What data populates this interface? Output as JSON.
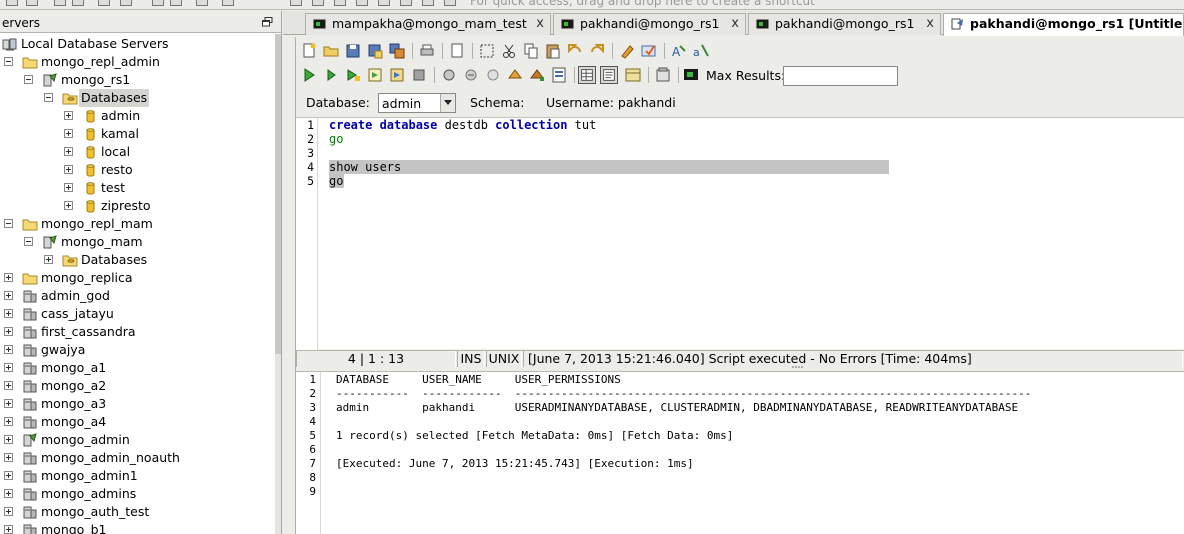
{
  "shortcut_hint": "For quick access, drag and drop here to create a shortcut",
  "left_panel": {
    "title": "ervers",
    "tree": [
      {
        "label": "Local Database Servers",
        "icon": "server-group-icon",
        "level": 0,
        "expander": "none"
      },
      {
        "label": "mongo_repl_admin",
        "icon": "folder-icon",
        "level": 1,
        "expander": "minus"
      },
      {
        "label": "mongo_rs1",
        "icon": "server-connected-icon",
        "level": 2,
        "expander": "minus"
      },
      {
        "label": "Databases",
        "icon": "databases-folder-icon",
        "level": 3,
        "expander": "minus",
        "selected": true
      },
      {
        "label": "admin",
        "icon": "database-icon",
        "level": 4,
        "expander": "plus"
      },
      {
        "label": "kamal",
        "icon": "database-icon",
        "level": 4,
        "expander": "plus"
      },
      {
        "label": "local",
        "icon": "database-icon",
        "level": 4,
        "expander": "plus"
      },
      {
        "label": "resto",
        "icon": "database-icon",
        "level": 4,
        "expander": "plus"
      },
      {
        "label": "test",
        "icon": "database-icon",
        "level": 4,
        "expander": "plus"
      },
      {
        "label": "zipresto",
        "icon": "database-icon",
        "level": 4,
        "expander": "plus"
      },
      {
        "label": "mongo_repl_mam",
        "icon": "folder-icon",
        "level": 1,
        "expander": "minus"
      },
      {
        "label": "mongo_mam",
        "icon": "server-connected-icon",
        "level": 2,
        "expander": "minus"
      },
      {
        "label": "Databases",
        "icon": "databases-folder-icon",
        "level": 3,
        "expander": "plus"
      },
      {
        "label": "mongo_replica",
        "icon": "folder-icon",
        "level": 1,
        "expander": "plus"
      },
      {
        "label": "admin_god",
        "icon": "server-icon",
        "level": 1,
        "expander": "plus"
      },
      {
        "label": "cass_jatayu",
        "icon": "server-icon",
        "level": 1,
        "expander": "plus"
      },
      {
        "label": "first_cassandra",
        "icon": "server-icon",
        "level": 1,
        "expander": "plus"
      },
      {
        "label": "gwajya",
        "icon": "server-icon",
        "level": 1,
        "expander": "plus"
      },
      {
        "label": "mongo_a1",
        "icon": "server-icon",
        "level": 1,
        "expander": "plus"
      },
      {
        "label": "mongo_a2",
        "icon": "server-icon",
        "level": 1,
        "expander": "plus"
      },
      {
        "label": "mongo_a3",
        "icon": "server-icon",
        "level": 1,
        "expander": "plus"
      },
      {
        "label": "mongo_a4",
        "icon": "server-icon",
        "level": 1,
        "expander": "plus"
      },
      {
        "label": "mongo_admin",
        "icon": "server-connected-icon",
        "level": 1,
        "expander": "plus"
      },
      {
        "label": "mongo_admin_noauth",
        "icon": "server-icon",
        "level": 1,
        "expander": "plus"
      },
      {
        "label": "mongo_admin1",
        "icon": "server-icon",
        "level": 1,
        "expander": "plus"
      },
      {
        "label": "mongo_admins",
        "icon": "server-icon",
        "level": 1,
        "expander": "plus"
      },
      {
        "label": "mongo_auth_test",
        "icon": "server-icon",
        "level": 1,
        "expander": "plus"
      },
      {
        "label": "mongo_b1",
        "icon": "server-icon",
        "level": 1,
        "expander": "plus"
      }
    ]
  },
  "tabs": [
    {
      "label": "mampakha@mongo_mam_test",
      "close": "x",
      "active": false
    },
    {
      "label": "pakhandi@mongo_rs1",
      "close": "x",
      "active": false
    },
    {
      "label": "pakhandi@mongo_rs1",
      "close": "x",
      "active": false
    },
    {
      "label": "pakhandi@mongo_rs1 [Untitle",
      "close": "",
      "active": true
    }
  ],
  "toolbar": {
    "max_results_label": "Max Results:",
    "max_results_value": ""
  },
  "db_bar": {
    "database_label": "Database:",
    "database_value": "admin",
    "schema_label": "Schema:",
    "username_label": "Username:",
    "username_value": "pakhandi"
  },
  "editor": {
    "lines": [
      {
        "num": "1",
        "tokens": [
          {
            "t": "create database",
            "c": "kw"
          },
          {
            "t": " destdb ",
            "c": ""
          },
          {
            "t": "collection",
            "c": "kw"
          },
          {
            "t": " tut",
            "c": ""
          }
        ]
      },
      {
        "num": "2",
        "tokens": [
          {
            "t": "go",
            "c": "gr"
          }
        ]
      },
      {
        "num": "3",
        "tokens": []
      },
      {
        "num": "4",
        "tokens": [
          {
            "t": "show users",
            "c": ""
          }
        ]
      },
      {
        "num": "5",
        "tokens": [
          {
            "t": "go",
            "c": ""
          }
        ]
      }
    ]
  },
  "status_bar": {
    "position": "4 | 1 : 13",
    "mode": "INS",
    "line_ending": "UNIX",
    "message": "[June 7, 2013 15:21:46.040] Script executed - No Errors [Time: 404ms]"
  },
  "result": {
    "lines": [
      {
        "num": "1",
        "text": "DATABASE     USER_NAME     USER_PERMISSIONS"
      },
      {
        "num": "2",
        "text": "-----------  ------------  ------------------------------------------------------------------------------"
      },
      {
        "num": "3",
        "text": "admin        pakhandi      USERADMINANYDATABASE, CLUSTERADMIN, DBADMINANYDATABASE, READWRITEANYDATABASE"
      },
      {
        "num": "4",
        "text": ""
      },
      {
        "num": "5",
        "text": "1 record(s) selected [Fetch MetaData: 0ms] [Fetch Data: 0ms]"
      },
      {
        "num": "6",
        "text": ""
      },
      {
        "num": "7",
        "text": "[Executed: June 7, 2013 15:21:45.743] [Execution: 1ms]"
      },
      {
        "num": "8",
        "text": ""
      },
      {
        "num": "9",
        "text": ""
      }
    ]
  }
}
